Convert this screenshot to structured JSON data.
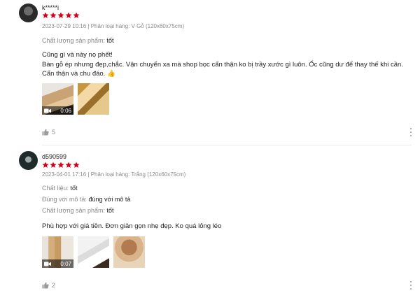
{
  "colors": {
    "star": "#d0011b",
    "muted": "#8a8a8a",
    "text": "#222222",
    "divider": "#ebebeb"
  },
  "reviews": [
    {
      "username": "k*****i",
      "rating": 5,
      "meta": "2023-07-29 10:16 | Phân loại hàng: V Gỗ (120x60x75cm)",
      "attributes": [
        {
          "label": "Chất lượng sản phẩm: ",
          "value": "tốt"
        }
      ],
      "body_line1": "Cũng gì và này nọ phết!",
      "body_line2": "Bàn gỗ ép nhưng đẹp,chắc. Vận chuyển xa mà shop bọc cẩn thận ko bị trầy xước gì luôn. Ốc cũng dư để thay thế khi cần. Cẩn thận và chu đáo. 👍",
      "media": [
        {
          "kind": "video",
          "duration": "0:06"
        },
        {
          "kind": "image"
        }
      ],
      "likes": "5",
      "icons": {
        "avatar": "avatar",
        "like": "thumbs-up-icon",
        "more": "more-vertical-icon",
        "video": "video-camera-icon"
      }
    },
    {
      "username": "d590599",
      "rating": 5,
      "meta": "2023-04-01 17:16 | Phân loại hàng: Trắng (120x60x75cm)",
      "attributes": [
        {
          "label": "Chất liệu: ",
          "value": "tốt"
        },
        {
          "label": "Đúng với mô tả: ",
          "value": "đúng với mô tả"
        },
        {
          "label": "Chất lượng sản phẩm: ",
          "value": "tốt"
        }
      ],
      "body_line1": "Phù hợp với giá tiền. Đơn giản gọn nhẹ đẹp. Ko quá lỏng léo",
      "media": [
        {
          "kind": "video",
          "duration": "0:07"
        },
        {
          "kind": "image"
        },
        {
          "kind": "image"
        }
      ],
      "likes": "2",
      "icons": {
        "avatar": "avatar",
        "like": "thumbs-up-icon",
        "more": "more-vertical-icon",
        "video": "video-camera-icon"
      }
    }
  ]
}
